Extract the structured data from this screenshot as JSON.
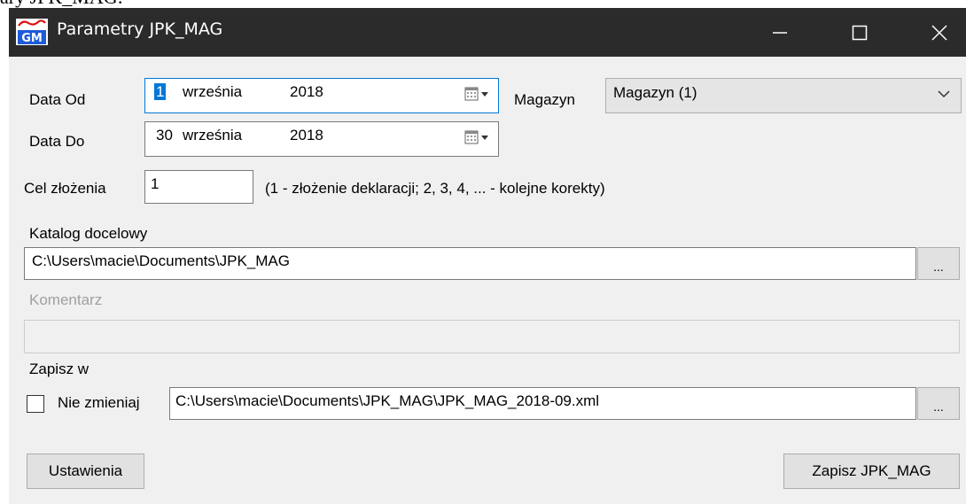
{
  "doc_caption": "ary JPK_MAG:",
  "window": {
    "title": "Parametry JPK_MAG",
    "app_icon": "gm-app-icon",
    "controls": {
      "minimize": "minimize-icon",
      "maximize": "maximize-icon",
      "close": "close-icon"
    }
  },
  "form": {
    "date_from_label": "Data Od",
    "date_from": {
      "day": "1",
      "month": "września",
      "year": "2018"
    },
    "date_to_label": "Data Do",
    "date_to": {
      "day": "30",
      "month": "września",
      "year": "2018"
    },
    "warehouse_label": "Magazyn",
    "warehouse_value": "Magazyn (1)",
    "purpose_label": "Cel złożenia",
    "purpose_value": "1",
    "purpose_hint": "(1 - złożenie deklaracji; 2, 3, 4, ... - kolejne korekty)",
    "target_dir_label": "Katalog docelowy",
    "target_dir_value": "C:\\Users\\macie\\Documents\\JPK_MAG",
    "browse_label": "...",
    "comment_label": "Komentarz",
    "comment_value": "",
    "save_in_label": "Zapisz w",
    "no_change_label": "Nie zmieniaj",
    "no_change_checked": false,
    "save_path_value": "C:\\Users\\macie\\Documents\\JPK_MAG\\JPK_MAG_2018-09.xml",
    "browse2_label": "..."
  },
  "buttons": {
    "settings": "Ustawienia",
    "save": "Zapisz JPK_MAG"
  }
}
